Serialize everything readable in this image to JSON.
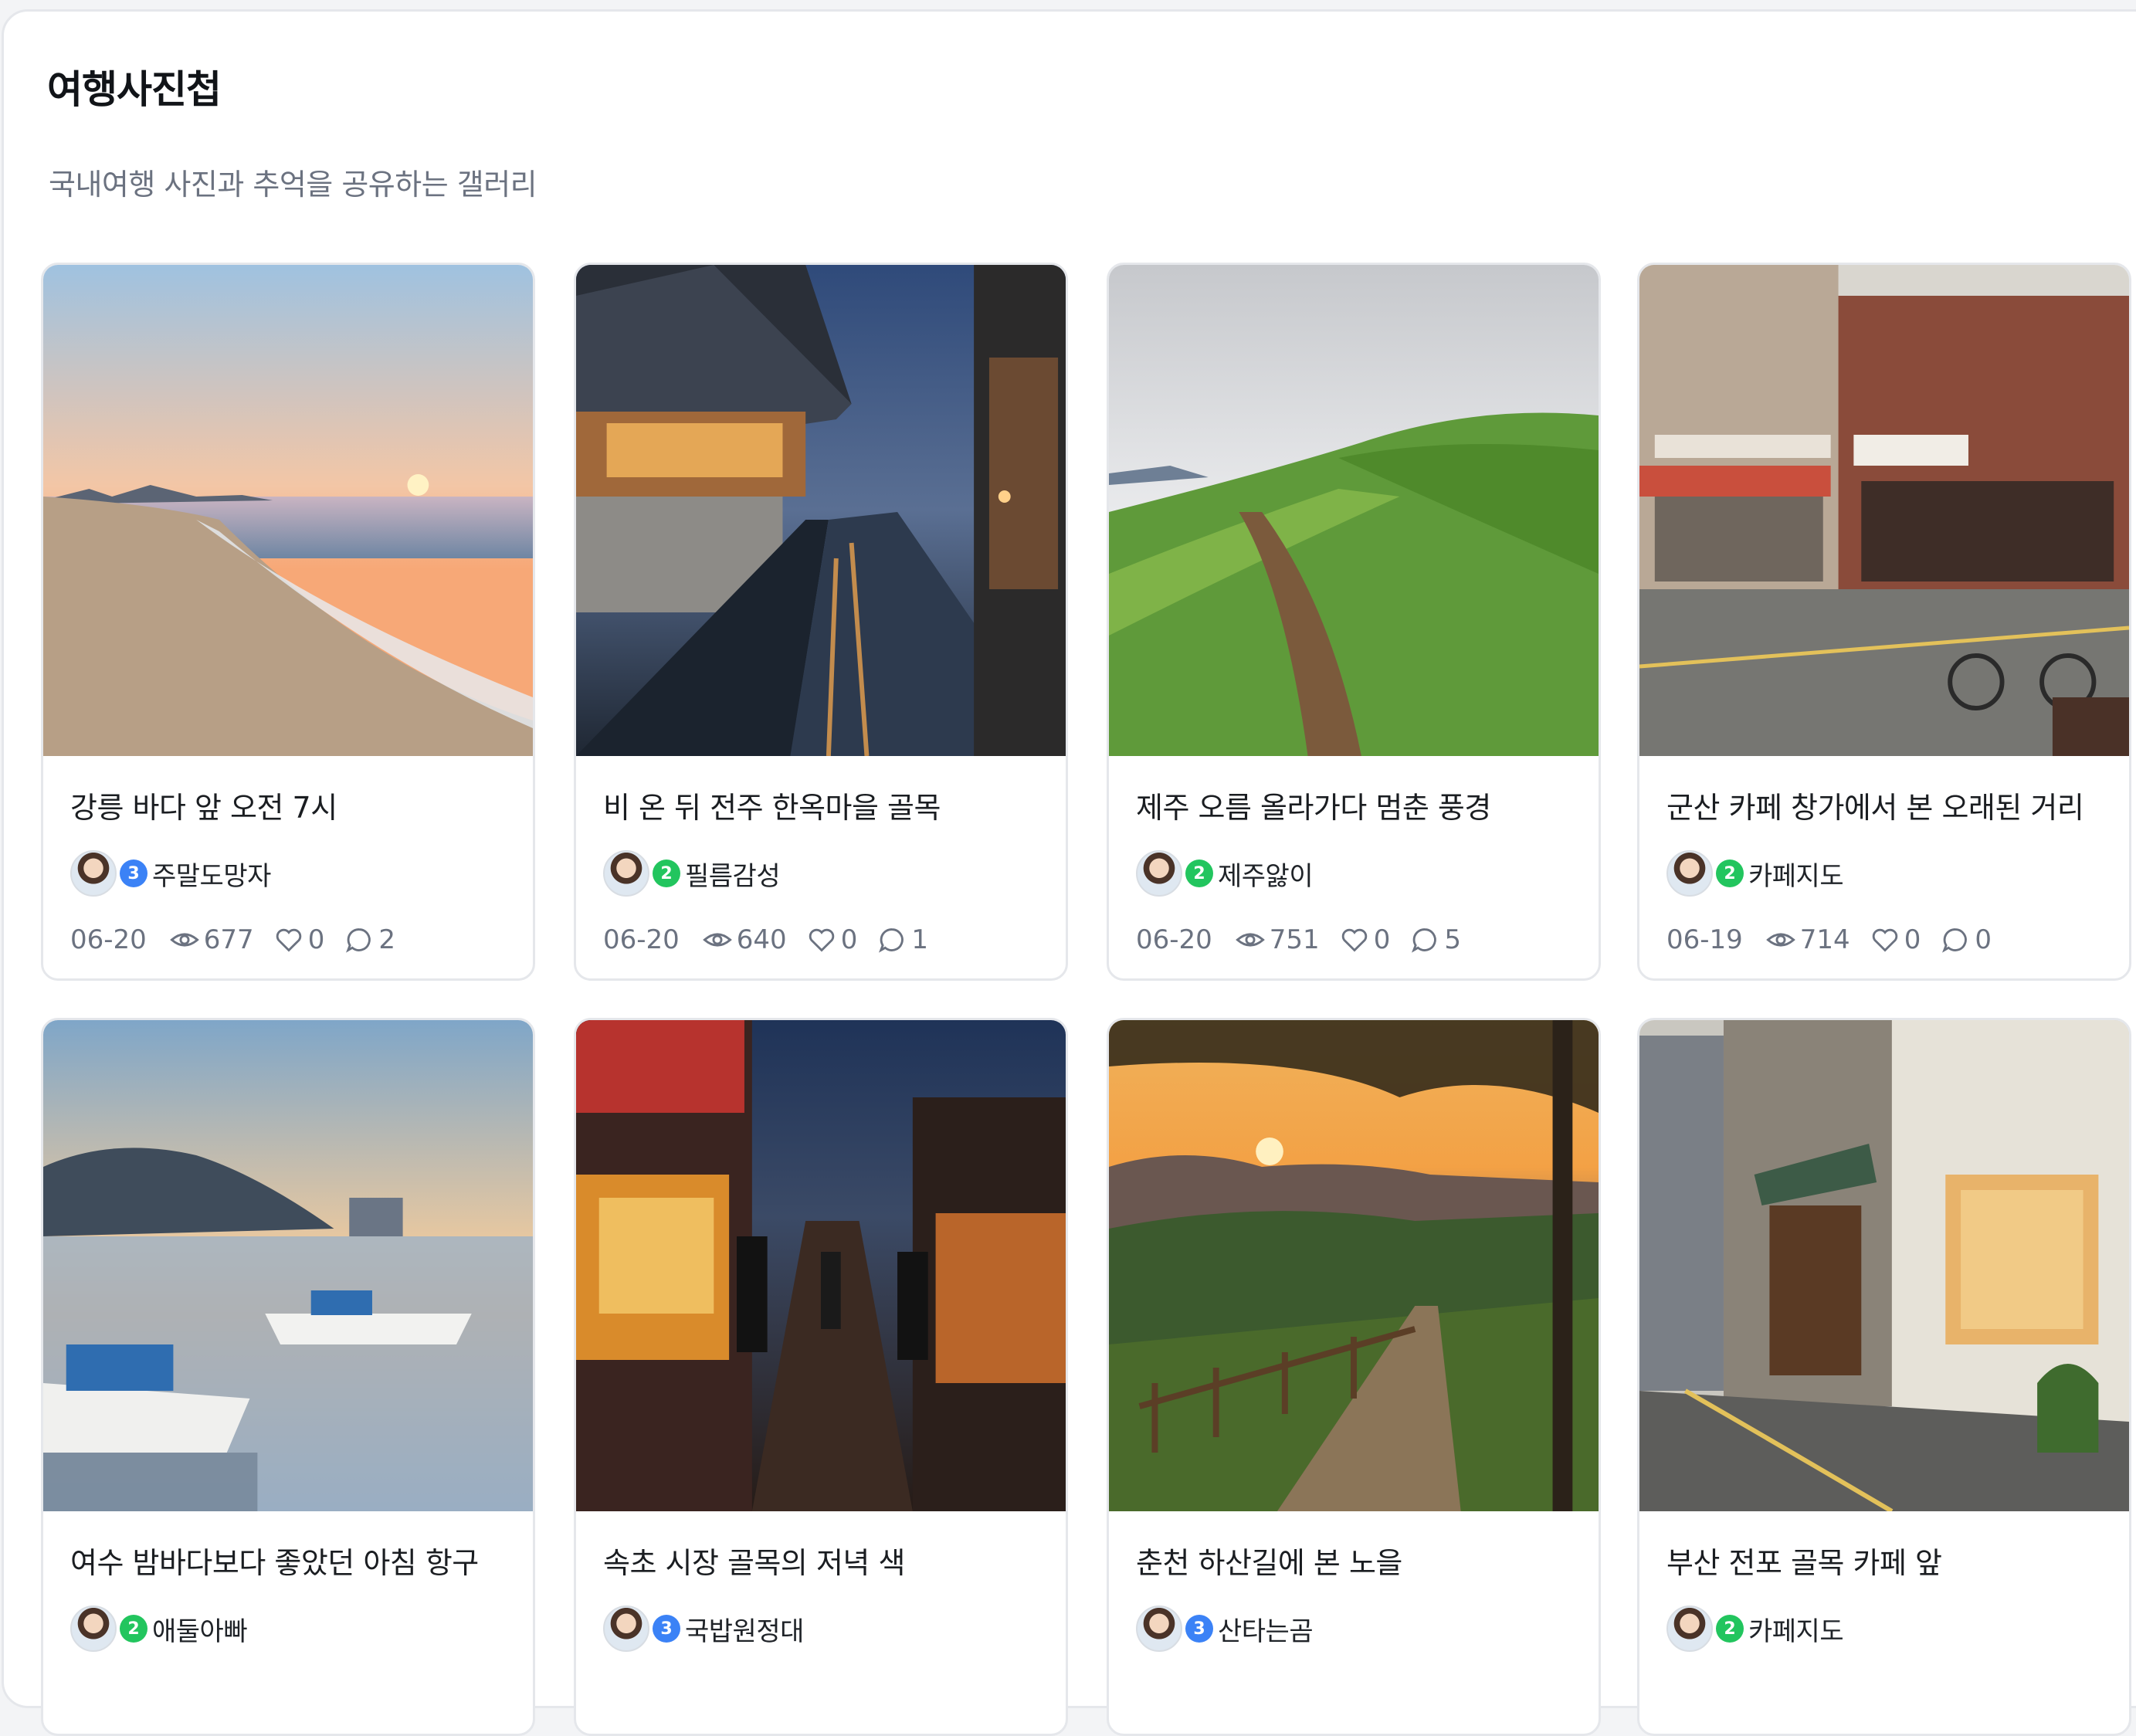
{
  "header": {
    "title": "여행사진첩",
    "subtitle": "국내여행 사진과 추억을 공유하는 갤러리"
  },
  "posts": [
    {
      "title": "강릉 바다 앞 오전 7시",
      "level": "3",
      "author": "주말도망자",
      "date": "06-20",
      "views": "677",
      "likes": "0",
      "comments": "2"
    },
    {
      "title": "비 온 뒤 전주 한옥마을 골목",
      "level": "2",
      "author": "필름감성",
      "date": "06-20",
      "views": "640",
      "likes": "0",
      "comments": "1"
    },
    {
      "title": "제주 오름 올라가다 멈춘 풍경",
      "level": "2",
      "author": "제주앓이",
      "date": "06-20",
      "views": "751",
      "likes": "0",
      "comments": "5"
    },
    {
      "title": "군산 카페 창가에서 본 오래된 거리",
      "level": "2",
      "author": "카페지도",
      "date": "06-19",
      "views": "714",
      "likes": "0",
      "comments": "0"
    },
    {
      "title": "여수 밤바다보다 좋았던 아침 항구",
      "level": "2",
      "author": "애둘아빠",
      "date": "",
      "views": "",
      "likes": "",
      "comments": ""
    },
    {
      "title": "속초 시장 골목의 저녁 색",
      "level": "3",
      "author": "국밥원정대",
      "date": "",
      "views": "",
      "likes": "",
      "comments": ""
    },
    {
      "title": "춘천 하산길에 본 노을",
      "level": "3",
      "author": "산타는곰",
      "date": "",
      "views": "",
      "likes": "",
      "comments": ""
    },
    {
      "title": "부산 전포 골목 카페 앞",
      "level": "2",
      "author": "카페지도",
      "date": "",
      "views": "",
      "likes": "",
      "comments": ""
    }
  ],
  "icons": {
    "views": "eye-icon",
    "likes": "heart-icon",
    "comments": "comment-icon"
  },
  "colors": {
    "level_3": "#3b82f6",
    "level_2": "#22c55e",
    "meta_text": "#6b7280"
  }
}
